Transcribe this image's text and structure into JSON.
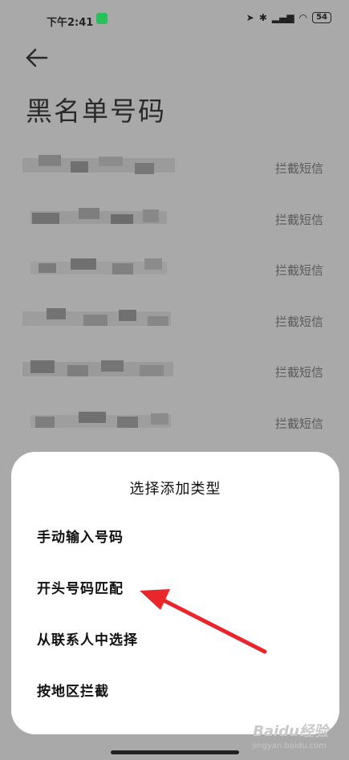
{
  "status_bar": {
    "time": "下午2:41",
    "battery": "54",
    "icons": [
      "location-icon",
      "bluetooth-icon",
      "signal-icon",
      "wifi-icon",
      "battery-icon"
    ]
  },
  "header": {
    "back_icon": "back-arrow-icon",
    "title": "黑名单号码"
  },
  "list": {
    "rows": [
      {
        "action": "拦截短信"
      },
      {
        "action": "拦截短信"
      },
      {
        "action": "拦截短信"
      },
      {
        "action": "拦截短信"
      },
      {
        "action": "拦截短信"
      },
      {
        "action": "拦截短信"
      }
    ]
  },
  "sheet": {
    "title": "选择添加类型",
    "options": [
      "手动输入号码",
      "开头号码匹配",
      "从联系人中选择",
      "按地区拦截"
    ]
  },
  "colors": {
    "dim_overlay": "#a9a9a9",
    "sheet_bg": "#ffffff",
    "annotation_arrow": "#e8262c"
  },
  "watermark": {
    "brand": "Baidu经验",
    "url": "jingyan.baidu.com"
  }
}
